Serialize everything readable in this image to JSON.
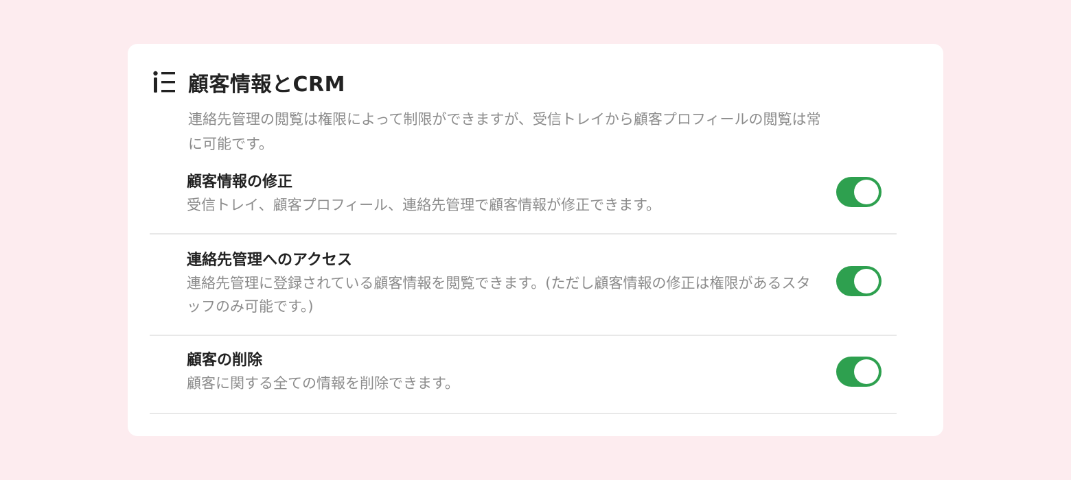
{
  "section": {
    "icon": "info-list-icon",
    "title": "顧客情報とCRM",
    "description": "連絡先管理の閲覧は権限によって制限ができますが、受信トレイから顧客プロフィールの閲覧は常に可能です。"
  },
  "settings": [
    {
      "title": "顧客情報の修正",
      "description": "受信トレイ、顧客プロフィール、連絡先管理で顧客情報が修正できます。",
      "enabled": true
    },
    {
      "title": "連絡先管理へのアクセス",
      "description": "連絡先管理に登録されている顧客情報を閲覧できます。(ただし顧客情報の修正は権限があるスタッフのみ可能です。)",
      "enabled": true
    },
    {
      "title": "顧客の削除",
      "description": "顧客に関する全ての情報を削除できます。",
      "enabled": true
    }
  ],
  "colors": {
    "background": "#fdecef",
    "toggle_on": "#2ea04f",
    "title_text": "#222222",
    "muted_text": "#8c8c8c"
  }
}
